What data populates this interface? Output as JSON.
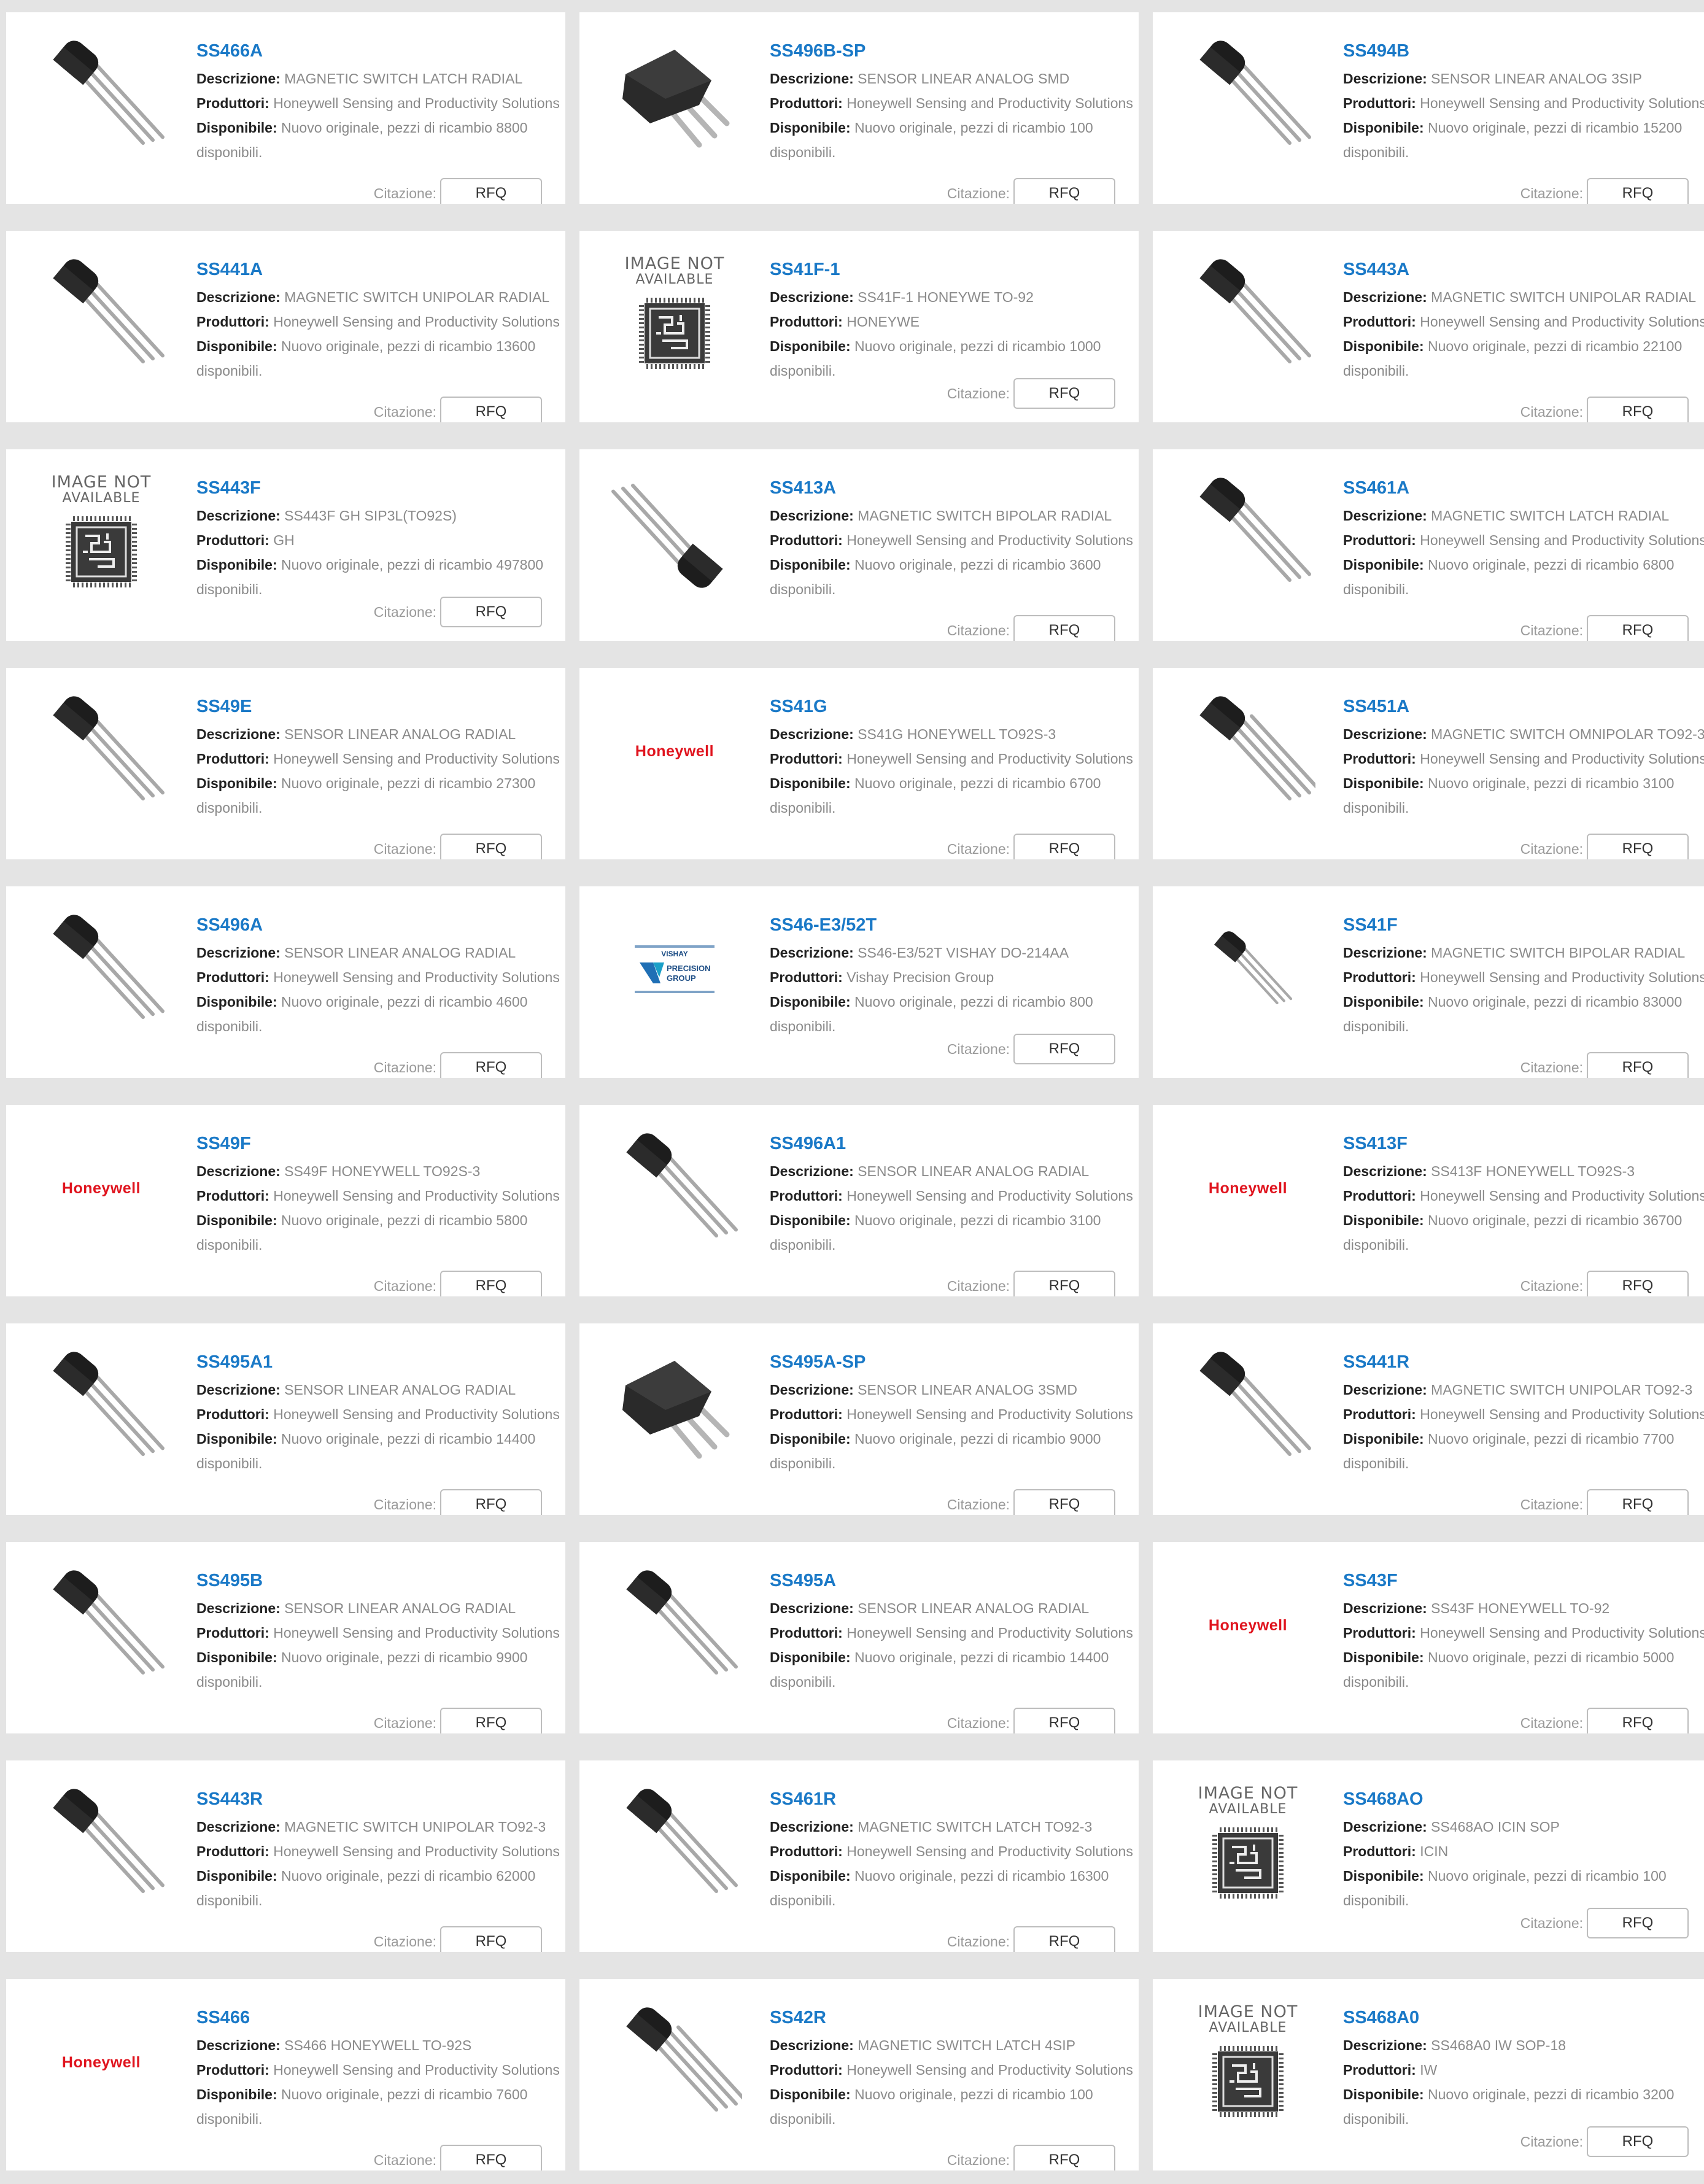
{
  "labels": {
    "description": "Descrizione:",
    "manufacturer": "Produttori:",
    "available": "Disponibile:",
    "quote": "Citazione:",
    "rfq": "RFQ",
    "image_not_available_1": "IMAGE NOT",
    "image_not_available_2": "AVAILABLE",
    "honeywell": "Honeywell",
    "vishay": "VISHAY PRECISION GROUP"
  },
  "products": [
    {
      "part": "SS466A",
      "img": "to92",
      "desc": "MAGNETIC SWITCH LATCH RADIAL",
      "mfr": "Honeywell Sensing and Productivity Solutions",
      "avail": "Nuovo originale, pezzi di ricambio 8800 disponibili."
    },
    {
      "part": "SS496B-SP",
      "img": "smd",
      "desc": "SENSOR LINEAR ANALOG SMD",
      "mfr": "Honeywell Sensing and Productivity Solutions",
      "avail": "Nuovo originale, pezzi di ricambio 100 disponibili."
    },
    {
      "part": "SS494B",
      "img": "to92",
      "desc": "SENSOR LINEAR ANALOG 3SIP",
      "mfr": "Honeywell Sensing and Productivity Solutions",
      "avail": "Nuovo originale, pezzi di ricambio 15200 disponibili."
    },
    {
      "part": "SS441A",
      "img": "to92",
      "desc": "MAGNETIC SWITCH UNIPOLAR RADIAL",
      "mfr": "Honeywell Sensing and Productivity Solutions",
      "avail": "Nuovo originale, pezzi di ricambio 13600 disponibili."
    },
    {
      "part": "SS41F-1",
      "img": "na",
      "desc": "SS41F-1 HONEYWE TO-92",
      "mfr": "HONEYWE",
      "avail": "Nuovo originale, pezzi di ricambio 1000 disponibili."
    },
    {
      "part": "SS443A",
      "img": "to92",
      "desc": "MAGNETIC SWITCH UNIPOLAR RADIAL",
      "mfr": "Honeywell Sensing and Productivity Solutions",
      "avail": "Nuovo originale, pezzi di ricambio 22100 disponibili."
    },
    {
      "part": "SS443F",
      "img": "na",
      "desc": "SS443F GH SIP3L(TO92S)",
      "mfr": "GH",
      "avail": "Nuovo originale, pezzi di ricambio 497800 disponibili."
    },
    {
      "part": "SS413A",
      "img": "to92r",
      "desc": "MAGNETIC SWITCH BIPOLAR RADIAL",
      "mfr": "Honeywell Sensing and Productivity Solutions",
      "avail": "Nuovo originale, pezzi di ricambio 3600 disponibili."
    },
    {
      "part": "SS461A",
      "img": "to92",
      "desc": "MAGNETIC SWITCH LATCH RADIAL",
      "mfr": "Honeywell Sensing and Productivity Solutions",
      "avail": "Nuovo originale, pezzi di ricambio 6800 disponibili."
    },
    {
      "part": "SS49E",
      "img": "to92",
      "desc": "SENSOR LINEAR ANALOG RADIAL",
      "mfr": "Honeywell Sensing and Productivity Solutions",
      "avail": "Nuovo originale, pezzi di ricambio 27300 disponibili."
    },
    {
      "part": "SS41G",
      "img": "honeywell",
      "desc": "SS41G HONEYWELL TO92S-3",
      "mfr": "Honeywell Sensing and Productivity Solutions",
      "avail": "Nuovo originale, pezzi di ricambio 6700 disponibili."
    },
    {
      "part": "SS451A",
      "img": "to92w",
      "desc": "MAGNETIC SWITCH OMNIPOLAR TO92-3",
      "mfr": "Honeywell Sensing and Productivity Solutions",
      "avail": "Nuovo originale, pezzi di ricambio 3100 disponibili."
    },
    {
      "part": "SS496A",
      "img": "to92l",
      "desc": "SENSOR LINEAR ANALOG RADIAL",
      "mfr": "Honeywell Sensing and Productivity Solutions",
      "avail": "Nuovo originale, pezzi di ricambio 4600 disponibili."
    },
    {
      "part": "SS46-E3/52T",
      "img": "vishay",
      "desc": "SS46-E3/52T VISHAY DO-214AA",
      "mfr": "Vishay Precision Group",
      "avail": "Nuovo originale, pezzi di ricambio 800 disponibili."
    },
    {
      "part": "SS41F",
      "img": "to92s",
      "desc": "MAGNETIC SWITCH BIPOLAR RADIAL",
      "mfr": "Honeywell Sensing and Productivity Solutions",
      "avail": "Nuovo originale, pezzi di ricambio 83000 disponibili."
    },
    {
      "part": "SS49F",
      "img": "honeywell",
      "desc": "SS49F HONEYWELL TO92S-3",
      "mfr": "Honeywell Sensing and Productivity Solutions",
      "avail": "Nuovo originale, pezzi di ricambio 5800 disponibili."
    },
    {
      "part": "SS496A1",
      "img": "to92l",
      "desc": "SENSOR LINEAR ANALOG RADIAL",
      "mfr": "Honeywell Sensing and Productivity Solutions",
      "avail": "Nuovo originale, pezzi di ricambio 3100 disponibili."
    },
    {
      "part": "SS413F",
      "img": "honeywell",
      "desc": "SS413F HONEYWELL TO92S-3",
      "mfr": "Honeywell Sensing and Productivity Solutions",
      "avail": "Nuovo originale, pezzi di ricambio 36700 disponibili."
    },
    {
      "part": "SS495A1",
      "img": "to92",
      "desc": "SENSOR LINEAR ANALOG RADIAL",
      "mfr": "Honeywell Sensing and Productivity Solutions",
      "avail": "Nuovo originale, pezzi di ricambio 14400 disponibili."
    },
    {
      "part": "SS495A-SP",
      "img": "smd",
      "desc": "SENSOR LINEAR ANALOG 3SMD",
      "mfr": "Honeywell Sensing and Productivity Solutions",
      "avail": "Nuovo originale, pezzi di ricambio 9000 disponibili."
    },
    {
      "part": "SS441R",
      "img": "to92",
      "desc": "MAGNETIC SWITCH UNIPOLAR TO92-3",
      "mfr": "Honeywell Sensing and Productivity Solutions",
      "avail": "Nuovo originale, pezzi di ricambio 7700 disponibili."
    },
    {
      "part": "SS495B",
      "img": "to92",
      "desc": "SENSOR LINEAR ANALOG RADIAL",
      "mfr": "Honeywell Sensing and Productivity Solutions",
      "avail": "Nuovo originale, pezzi di ricambio 9900 disponibili."
    },
    {
      "part": "SS495A",
      "img": "to92",
      "desc": "SENSOR LINEAR ANALOG RADIAL",
      "mfr": "Honeywell Sensing and Productivity Solutions",
      "avail": "Nuovo originale, pezzi di ricambio 14400 disponibili."
    },
    {
      "part": "SS43F",
      "img": "honeywell",
      "desc": "SS43F HONEYWELL TO-92",
      "mfr": "Honeywell Sensing and Productivity Solutions",
      "avail": "Nuovo originale, pezzi di ricambio 5000 disponibili."
    },
    {
      "part": "SS443R",
      "img": "to92",
      "desc": "MAGNETIC SWITCH UNIPOLAR TO92-3",
      "mfr": "Honeywell Sensing and Productivity Solutions",
      "avail": "Nuovo originale, pezzi di ricambio 62000 disponibili."
    },
    {
      "part": "SS461R",
      "img": "to92",
      "desc": "MAGNETIC SWITCH LATCH TO92-3",
      "mfr": "Honeywell Sensing and Productivity Solutions",
      "avail": "Nuovo originale, pezzi di ricambio 16300 disponibili."
    },
    {
      "part": "SS468AO",
      "img": "na",
      "desc": "SS468AO ICIN SOP",
      "mfr": "ICIN",
      "avail": "Nuovo originale, pezzi di ricambio 100 disponibili."
    },
    {
      "part": "SS466",
      "img": "honeywell",
      "desc": "SS466 HONEYWELL TO-92S",
      "mfr": "Honeywell Sensing and Productivity Solutions",
      "avail": "Nuovo originale, pezzi di ricambio 7600 disponibili."
    },
    {
      "part": "SS42R",
      "img": "to92w",
      "desc": "MAGNETIC SWITCH LATCH 4SIP",
      "mfr": "Honeywell Sensing and Productivity Solutions",
      "avail": "Nuovo originale, pezzi di ricambio 100 disponibili."
    },
    {
      "part": "SS468A0",
      "img": "na",
      "desc": "SS468A0 IW SOP-18",
      "mfr": "IW",
      "avail": "Nuovo originale, pezzi di ricambio 3200 disponibili."
    }
  ]
}
